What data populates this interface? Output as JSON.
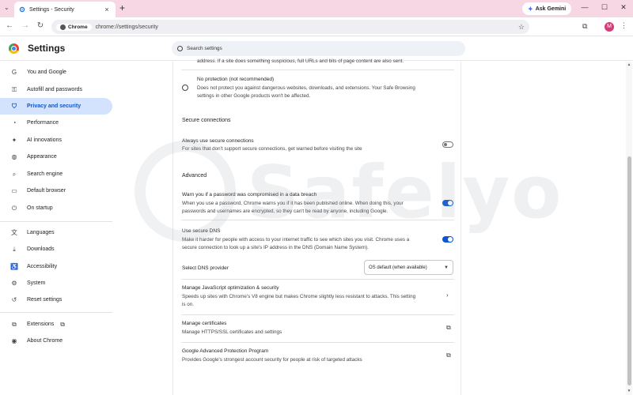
{
  "tab": {
    "title": "Settings - Security",
    "close": "×"
  },
  "newtab_label": "+",
  "gemini": {
    "label": "Ask Gemini"
  },
  "window": {
    "minimize": "—",
    "maximize": "☐",
    "close": "✕"
  },
  "omnibox": {
    "chip": "Chrome",
    "url": "chrome://settings/security"
  },
  "avatar_letter": "M",
  "settings": {
    "title": "Settings",
    "search_placeholder": "Search settings"
  },
  "sidebar": {
    "items": [
      {
        "label": "You and Google",
        "icon": "G"
      },
      {
        "label": "Autofill and passwords",
        "icon": "⚿"
      },
      {
        "label": "Privacy and security",
        "icon": "⛉"
      },
      {
        "label": "Performance",
        "icon": "◔"
      },
      {
        "label": "AI innovations",
        "icon": "✦"
      },
      {
        "label": "Appearance",
        "icon": "◍"
      },
      {
        "label": "Search engine",
        "icon": "⌕"
      },
      {
        "label": "Default browser",
        "icon": "▭"
      },
      {
        "label": "On startup",
        "icon": "⏻"
      },
      {
        "label": "Languages",
        "icon": "文"
      },
      {
        "label": "Downloads",
        "icon": "⤓"
      },
      {
        "label": "Accessibility",
        "icon": "♿"
      },
      {
        "label": "System",
        "icon": "⚙"
      },
      {
        "label": "Reset settings",
        "icon": "↺"
      },
      {
        "label": "Extensions",
        "icon": "⧉"
      },
      {
        "label": "About Chrome",
        "icon": "◉"
      }
    ]
  },
  "content": {
    "cut_text": "address. If a site does something suspicious, full URLs and bits of page content are also sent.",
    "no_protection": {
      "title": "No protection (not recommended)",
      "desc1": "Does not protect you against dangerous websites, downloads, and extensions. Your Safe Browsing",
      "desc2": "settings in other Google products won't be affected."
    },
    "secure_connections_heading": "Secure connections",
    "always_secure": {
      "title": "Always use secure connections",
      "desc": "For sites that don't support secure connections, get warned before visiting the site"
    },
    "advanced_heading": "Advanced",
    "password_breach": {
      "title": "Warn you if a password was compromised in a data breach",
      "desc1": "When you use a password, Chrome warns you if it has been published online. When doing this, your",
      "desc2": "passwords and usernames are encrypted, so they can't be read by anyone, including Google."
    },
    "secure_dns": {
      "title": "Use secure DNS",
      "desc1": "Make it harder for people with access to your internet traffic to see which sites you visit. Chrome uses a",
      "desc2": "secure connection to look up a site's IP address in the DNS (Domain Name System)."
    },
    "dns_provider": {
      "label": "Select DNS provider",
      "value": "OS default (when available)"
    },
    "js_optimization": {
      "title": "Manage JavaScript optimization & security",
      "desc1": "Speeds up sites with Chrome's V8 engine but makes Chrome slightly less resistant to attacks. This setting",
      "desc2": "is on."
    },
    "certificates": {
      "title": "Manage certificates",
      "desc": "Manage HTTPS/SSL certificates and settings"
    },
    "advanced_protection": {
      "title": "Google Advanced Protection Program",
      "desc": "Provides Google's strongest account security for people at risk of targeted attacks"
    }
  },
  "watermark": "Safelyo",
  "colors": {
    "accent": "#0b57d0",
    "active_bg": "#d3e3fd",
    "tabstrip": "#f8d7e4"
  }
}
